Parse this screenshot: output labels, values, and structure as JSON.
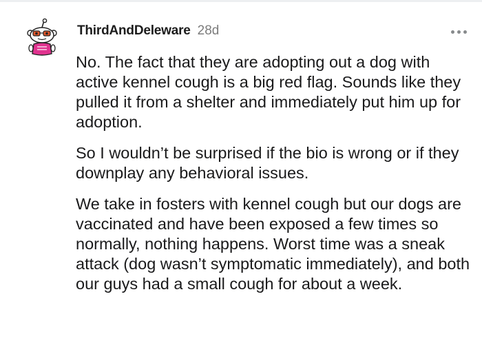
{
  "comment": {
    "author": "ThirdAndDeleware",
    "age": "28d",
    "avatar_icon": "snoo-avatar-icon",
    "more_icon": "more-options-icon",
    "paragraphs": [
      "No. The fact that they are adopting out a dog with active kennel cough is a big red flag. Sounds like they pulled it from a shelter and immediately put him up for adoption.",
      "So I wouldn’t be surprised if the bio is wrong or if they downplay any behavioral issues.",
      "We take in fosters with kennel cough but our dogs are vaccinated and have been exposed a few times so normally, nothing happens. Worst time was a sneak attack (dog wasn’t symptomatic immediately), and both our guys had a small cough for about a week."
    ]
  },
  "colors": {
    "avatar_pink": "#e0338f",
    "avatar_glasses": "#e0562a",
    "muted": "#7c7c7c"
  }
}
